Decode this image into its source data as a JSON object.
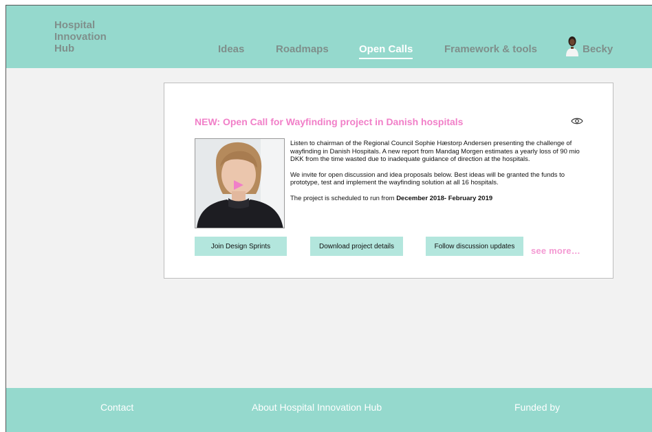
{
  "header": {
    "logo_lines": [
      "Hospital",
      "Innovation",
      "Hub"
    ],
    "nav": [
      {
        "label": "Ideas",
        "active": false
      },
      {
        "label": "Roadmaps",
        "active": false
      },
      {
        "label": "Open Calls",
        "active": true
      },
      {
        "label": "Framework & tools",
        "active": false
      }
    ],
    "user": {
      "name": "Becky",
      "avatar_icon": "user-avatar-icon"
    }
  },
  "open_call": {
    "title": "NEW: Open Call for Wayfinding project in Danish hospitals",
    "view_icon": "eye-icon",
    "video_play_icon": "play-icon",
    "paragraph_1": "Listen to chairman of the Regional Council Sophie Hæstorp Andersen presenting the challenge of wayfinding in Danish Hospitals. A new report from Mandag Morgen estimates a yearly loss of 90 mio DKK from the time wasted due to inadequate guidance of direction at the hospitals.",
    "paragraph_2": "We invite for open discussion and idea proposals below. Best ideas will be granted the funds to prototype, test and implement the wayfinding solution at all 16 hospitals.",
    "schedule_prefix": "The project is scheduled to run from ",
    "schedule_dates": "December 2018- February 2019",
    "buttons": {
      "join": "Join Design Sprints",
      "download": "Download project details",
      "follow": "Follow discussion updates"
    },
    "see_more": "see more…"
  },
  "footer": {
    "contact": "Contact",
    "about": "About Hospital Innovation Hub",
    "funded": "Funded by"
  },
  "colors": {
    "brand_teal": "#95d9cd",
    "button_teal": "#b3e6dd",
    "accent_pink": "#f17fc8",
    "nav_gray": "#7f8f8b"
  }
}
